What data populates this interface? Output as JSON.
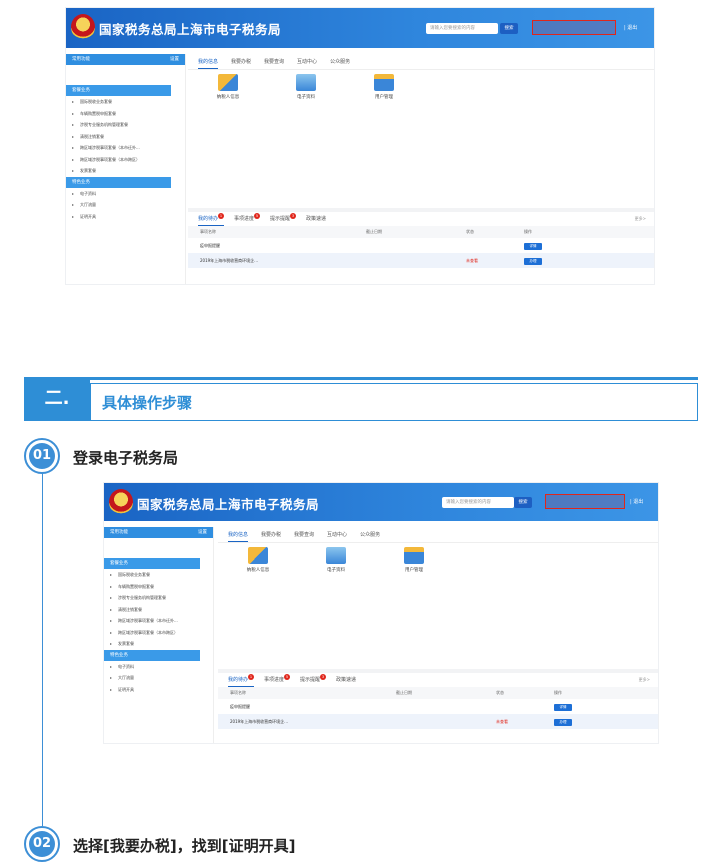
{
  "portal": {
    "title": "国家税务总局上海市电子税务局",
    "search_placeholder": "请输入您要搜索的内容",
    "search_btn": "搜索",
    "logout": "退出",
    "common_funcs": "常用功能",
    "settings": "设置",
    "sidebar_section1": "套餐业务",
    "sidebar_items1": [
      "国际税收业务套餐",
      "车辆购置税申报套餐",
      "涉税专业服务机构管理套餐",
      "清税注销套餐",
      "跨区域涉税事项套餐（本市迁外...",
      "跨区域涉税事项套餐（本市跨区）",
      "发票套餐"
    ],
    "sidebar_section2": "特色业务",
    "sidebar_items2": [
      "电子资料",
      "大厅流量",
      "证明开具"
    ],
    "tabs": [
      "我的信息",
      "我要办税",
      "我要查询",
      "互动中心",
      "公众服务"
    ],
    "icons": [
      "纳税人信息",
      "电子资料",
      "用户管理"
    ],
    "todo_tabs": [
      "我的待办",
      "事项进度",
      "提示提醒",
      "政策速递"
    ],
    "more": "更多>",
    "table_headers": [
      "事项名称",
      "截止日期",
      "状态",
      "操作"
    ],
    "rows": [
      {
        "name": "疫申报提醒",
        "date": "",
        "status": "",
        "op": "详情"
      },
      {
        "name": "2019年上海市税收营商环境企...",
        "date": "",
        "status": "未查看",
        "op": "办理"
      }
    ]
  },
  "section": {
    "number": "二.",
    "title": "具体操作步骤"
  },
  "steps": [
    {
      "num": "01",
      "text": "登录电子税务局"
    },
    {
      "num": "02",
      "text": "选择[我要办税]，找到[证明开具]"
    }
  ]
}
